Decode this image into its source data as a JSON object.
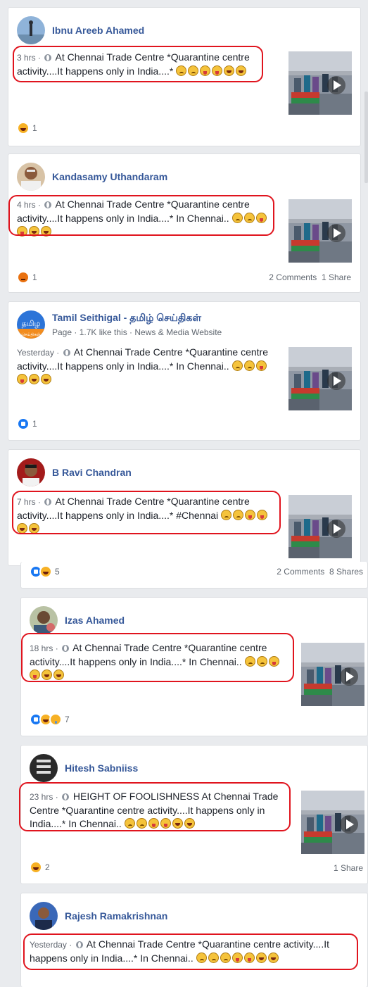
{
  "posts": [
    {
      "name": "Ibnu Areeb Ahamed",
      "time": "3 hrs",
      "text": "At Chennai Trade Centre *Quarantine centre activity....It happens only in India....*",
      "react_count": "1"
    },
    {
      "name": "Kandasamy Uthandaram",
      "time": "4 hrs",
      "text": "At Chennai Trade Centre *Quarantine centre activity....It happens only in India....* In Chennai..",
      "react_count": "1",
      "comments": "2 Comments",
      "shares": "1 Share"
    },
    {
      "name": "Tamil Seithigal - தமிழ் செய்திகள்",
      "sub": "Page · 1.7K like this · News & Media Website",
      "avatar_text": "தமிழ",
      "avatar_text2": "செய்திகள்",
      "time": "Yesterday",
      "text": "At Chennai Trade Centre *Quarantine centre activity....It happens only in India....* In Chennai..",
      "react_count": "1"
    },
    {
      "name": "B Ravi Chandran",
      "time": "7 hrs",
      "text": "At Chennai Trade Centre *Quarantine centre activity....It happens only in India....* #Chennai",
      "react_count": "5",
      "comments": "2 Comments",
      "shares": "8 Shares"
    },
    {
      "name": "Izas Ahamed",
      "time": "18 hrs",
      "text": "At Chennai Trade Centre *Quarantine centre activity....It happens only in India....* In Chennai..",
      "react_count": "7"
    },
    {
      "name": "Hitesh Sabniiss",
      "time": "23 hrs",
      "text": "HEIGHT OF FOOLISHNESS At Chennai Trade Centre *Quarantine centre activity....It happens only in India....* In Chennai..",
      "react_count": "2",
      "shares": "1 Share"
    },
    {
      "name": "Rajesh Ramakrishnan",
      "time": "Yesterday",
      "text": "At Chennai Trade Centre *Quarantine centre activity....It happens only in India....* In Chennai.."
    }
  ],
  "colors": {
    "highlight": "#e0141e",
    "name": "#365899",
    "background": "#e9ebee"
  },
  "icons": {
    "privacy": "globe-icon",
    "video": "play-icon"
  }
}
